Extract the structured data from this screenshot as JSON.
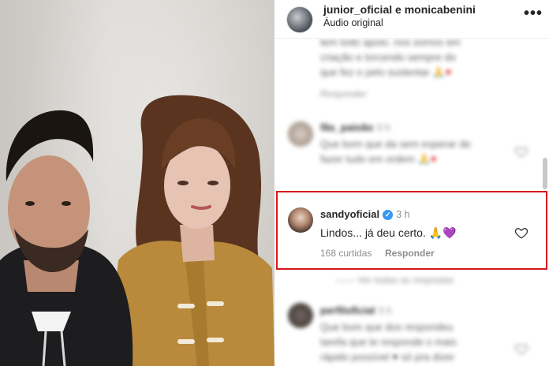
{
  "post_header": {
    "usernames": "junior_oficial e monicabenini",
    "audio": "Áudio original",
    "more": "•••"
  },
  "comments": {
    "blurred_1": {
      "lines": [
        "tem todo apoio. nos somos em",
        "criação e torcendo sempre do",
        "que fez o pelo sustentar"
      ],
      "meta": "Responder"
    },
    "blurred_2": {
      "user": "fãs_paixão",
      "time": "3 h",
      "lines": [
        "Que bom que da sem esperar de",
        "fazer tudo em ordem 🙏"
      ]
    },
    "highlighted": {
      "user": "sandyoficial",
      "time": "3 h",
      "text": "Lindos... já deu certo.",
      "emoji_hands": "🙏",
      "emoji_heart": "💜",
      "likes": "168 curtidas",
      "reply": "Responder"
    },
    "replies_toggle": "Ver todas as respostas",
    "blurred_3": {
      "user": "perfiloficial",
      "time": "3 h",
      "lines": [
        "Que bom que dos respondeu",
        "tarefa que te responde o mais",
        "rápido possível ♥ só pra dizer"
      ]
    }
  },
  "colors": {
    "highlight_border": "#d8171a",
    "verified": "#3897f0",
    "meta_text": "#8e8e8e"
  },
  "icons": {
    "like": "heart-outline-icon",
    "more": "more-horizontal-icon",
    "verified": "verified-badge-icon"
  }
}
